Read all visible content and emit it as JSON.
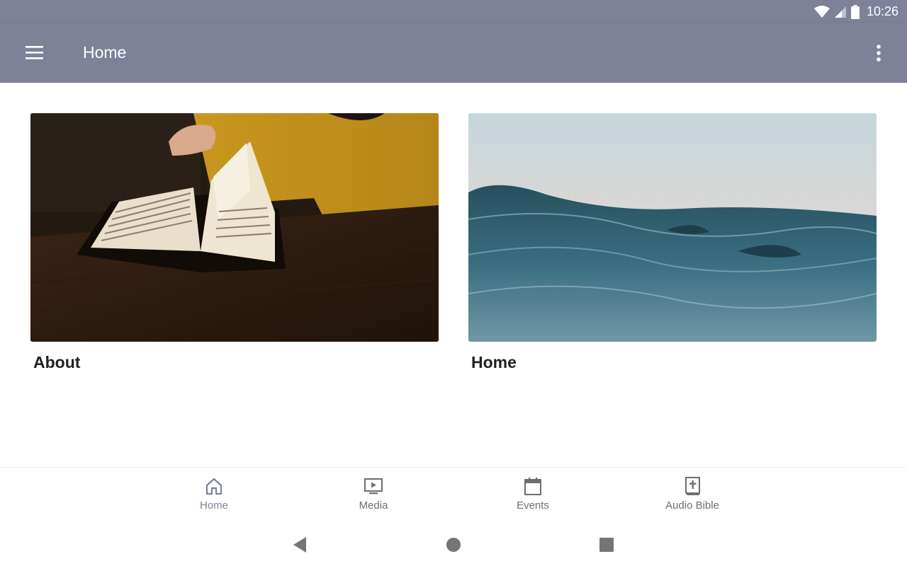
{
  "status_bar": {
    "time": "10:26",
    "icons": [
      "wifi-icon",
      "cell-signal-icon",
      "battery-icon"
    ],
    "background": "#7d8299"
  },
  "app_bar": {
    "title": "Home",
    "menu_icon": "hamburger-menu-icon",
    "overflow_icon": "more-vertical-icon",
    "background": "#7d8299"
  },
  "cards": [
    {
      "title": "About",
      "image": "open-bible-on-wooden-table-photo"
    },
    {
      "title": "Home",
      "image": "ocean-waves-at-dusk-photo"
    }
  ],
  "bottom_nav": {
    "items": [
      {
        "label": "Home",
        "icon": "home-icon",
        "active": true
      },
      {
        "label": "Media",
        "icon": "tv-play-icon",
        "active": false
      },
      {
        "label": "Events",
        "icon": "calendar-icon",
        "active": false
      },
      {
        "label": "Audio Bible",
        "icon": "bible-cross-icon",
        "active": false
      }
    ],
    "accent": "#7d8299",
    "inactive_color": "#6e6e6e"
  },
  "system_nav": {
    "icons": [
      "back-triangle-icon",
      "home-circle-icon",
      "recents-square-icon"
    ]
  }
}
